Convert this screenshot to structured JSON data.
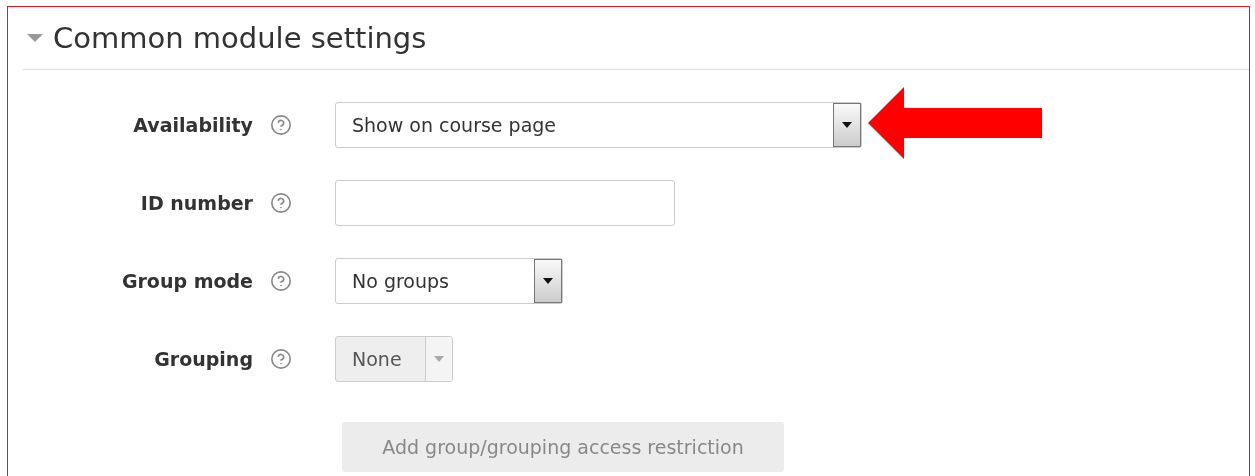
{
  "section": {
    "title": "Common module settings",
    "expanded": true
  },
  "fields": [
    {
      "label": "Availability",
      "kind": "select",
      "value": "Show on course page",
      "disabled": false
    },
    {
      "label": "ID number",
      "kind": "text",
      "disabled": false
    },
    {
      "label": "Group mode",
      "kind": "select",
      "value": "No groups",
      "disabled": false
    },
    {
      "label": "Grouping",
      "kind": "select",
      "value": "None",
      "disabled": true
    }
  ],
  "button": {
    "label": "Add group/grouping access restriction",
    "disabled": true
  }
}
